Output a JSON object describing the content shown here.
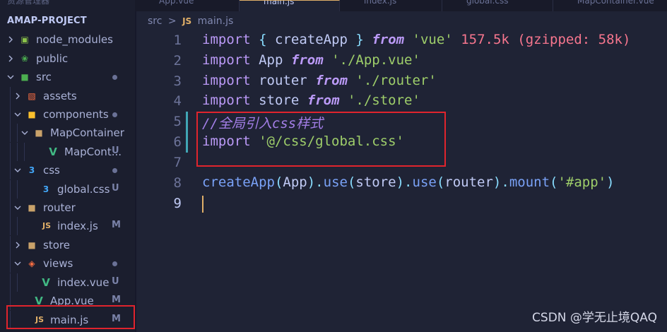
{
  "explorer": {
    "header_partial": "资源管理器",
    "project_name": "AMAP-PROJECT",
    "items": [
      {
        "label": "node_modules",
        "icon": "node-modules-folder-icon",
        "icon_color": "#8bc34a",
        "chevron": "right",
        "status": ""
      },
      {
        "label": "public",
        "icon": "public-folder-icon",
        "icon_color": "#4caf50",
        "chevron": "right",
        "status": ""
      },
      {
        "label": "src",
        "icon": "src-folder-icon",
        "icon_color": "#4caf50",
        "chevron": "down",
        "status": "dot"
      },
      {
        "label": "assets",
        "icon": "assets-folder-icon",
        "icon_color": "#ff7043",
        "chevron": "right",
        "status": ""
      },
      {
        "label": "components",
        "icon": "components-folder-icon",
        "icon_color": "#fbc02d",
        "chevron": "down",
        "status": "dot"
      },
      {
        "label": "MapContainer",
        "icon": "folder-open-icon",
        "icon_color": "#c9a26a",
        "chevron": "down",
        "status": ""
      },
      {
        "label": "MapCont...",
        "icon": "vue-file-icon",
        "icon_color": "#41b883",
        "chevron": "",
        "status": "U"
      },
      {
        "label": "css",
        "icon": "css-folder-icon",
        "icon_color": "#42a5f5",
        "chevron": "down",
        "status": "dot"
      },
      {
        "label": "global.css",
        "icon": "css-file-icon",
        "icon_color": "#42a5f5",
        "chevron": "",
        "status": "U"
      },
      {
        "label": "router",
        "icon": "folder-open-icon",
        "icon_color": "#c9a26a",
        "chevron": "down",
        "status": ""
      },
      {
        "label": "index.js",
        "icon": "js-file-icon",
        "icon_color": "#e0af68",
        "chevron": "",
        "status": "M"
      },
      {
        "label": "store",
        "icon": "folder-icon",
        "icon_color": "#c9a26a",
        "chevron": "right",
        "status": ""
      },
      {
        "label": "views",
        "icon": "views-folder-icon",
        "icon_color": "#ff7043",
        "chevron": "down",
        "status": "dot"
      },
      {
        "label": "index.vue",
        "icon": "vue-file-icon",
        "icon_color": "#41b883",
        "chevron": "",
        "status": "U"
      },
      {
        "label": "App.vue",
        "icon": "vue-file-icon",
        "icon_color": "#41b883",
        "chevron": "",
        "status": "M"
      },
      {
        "label": "main.js",
        "icon": "js-file-icon",
        "icon_color": "#e0af68",
        "chevron": "",
        "status": "M"
      }
    ]
  },
  "tabs": [
    {
      "label": "App.vue",
      "icon": "vue-file-icon",
      "active": false
    },
    {
      "label": "main.js",
      "icon": "js-file-icon",
      "active": true
    },
    {
      "label": "index.js",
      "icon": "js-file-icon",
      "active": false
    },
    {
      "label": "global.css",
      "icon": "css-file-icon",
      "active": false
    },
    {
      "label": "MapContainer.vue",
      "icon": "vue-file-icon",
      "active": false
    }
  ],
  "breadcrumb": {
    "folder": "src",
    "separator": ">",
    "file_icon_text": "JS",
    "file": "main.js"
  },
  "code": {
    "line_numbers": [
      "1",
      "2",
      "3",
      "4",
      "5",
      "6",
      "7",
      "8",
      "9"
    ],
    "line1": {
      "kw": "import",
      "ob": "{",
      "id": "createApp",
      "cb": "}",
      "from": "from",
      "str": "'vue'",
      "hint": "157.5k (gzipped: 58k)"
    },
    "line2": {
      "kw": "import",
      "id": "App",
      "from": "from",
      "str": "'./App.vue'"
    },
    "line3": {
      "kw": "import",
      "id": "router",
      "from": "from",
      "str": "'./router'"
    },
    "line4": {
      "kw": "import",
      "id": "store",
      "from": "from",
      "str": "'./store'"
    },
    "line5": {
      "comment": "//全局引入css样式"
    },
    "line6": {
      "kw": "import",
      "str": "'@/css/global.css'"
    },
    "line8": {
      "f1": "createApp",
      "p1": "(",
      "a1": "App",
      "p2": ").",
      "f2": "use",
      "p3": "(",
      "a2": "store",
      "p4": ").",
      "f3": "use",
      "p5": "(",
      "a3": "router",
      "p6": ").",
      "f4": "mount",
      "p7": "(",
      "s1": "'#app'",
      "p8": ")"
    }
  },
  "watermark": "CSDN @学无止境QAQ",
  "colors": {
    "highlight_box": "#e0242d",
    "accent_tab": "#e0af68"
  }
}
